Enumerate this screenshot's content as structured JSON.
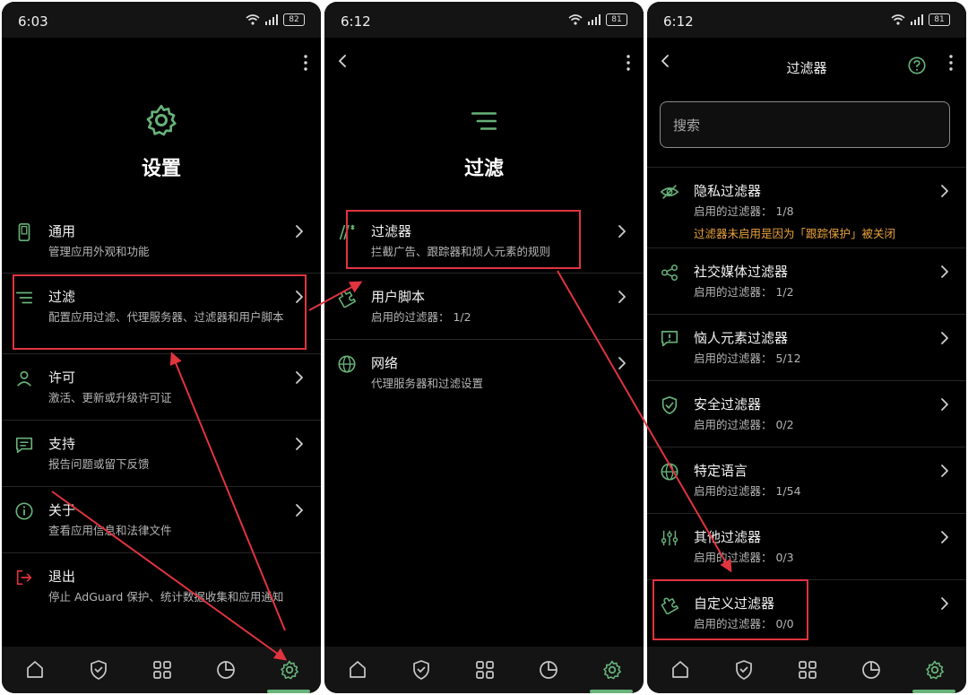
{
  "colors": {
    "accent": "#67b279",
    "highlight": "#e0343f",
    "warning": "#e9a23b"
  },
  "screens": [
    {
      "time": "6:03",
      "battery": "82",
      "title": "设置",
      "items": [
        {
          "icon": "phone-icon",
          "title": "通用",
          "subtitle": "管理应用外观和功能"
        },
        {
          "icon": "filter-lines-icon",
          "title": "过滤",
          "subtitle": "配置应用过滤、代理服务器、过滤器和用户脚本"
        },
        {
          "icon": "person-icon",
          "title": "许可",
          "subtitle": "激活、更新或升级许可证"
        },
        {
          "icon": "chat-icon",
          "title": "支持",
          "subtitle": "报告问题或留下反馈"
        },
        {
          "icon": "info-icon",
          "title": "关于",
          "subtitle": "查看应用信息和法律文件"
        },
        {
          "icon": "exit-icon",
          "title": "退出",
          "subtitle": "停止 AdGuard 保护、统计数据收集和应用通知"
        }
      ]
    },
    {
      "time": "6:12",
      "battery": "81",
      "title": "过滤",
      "items": [
        {
          "icon": "filters-icon",
          "title": "过滤器",
          "subtitle": "拦截广告、跟踪器和烦人元素的规则"
        },
        {
          "icon": "puzzle-icon",
          "title": "用户脚本",
          "subtitle": "启用的过滤器： 1/2"
        },
        {
          "icon": "globe-icon",
          "title": "网络",
          "subtitle": "代理服务器和过滤设置"
        }
      ]
    },
    {
      "time": "6:12",
      "battery": "81",
      "title": "过滤器",
      "search_placeholder": "搜索",
      "items": [
        {
          "icon": "eye-off-icon",
          "title": "隐私过滤器",
          "subtitle": "启用的过滤器： 1/8",
          "warning": "过滤器未启用是因为「跟踪保护」被关闭"
        },
        {
          "icon": "share-icon",
          "title": "社交媒体过滤器",
          "subtitle": "启用的过滤器： 1/2"
        },
        {
          "icon": "alert-message-icon",
          "title": "恼人元素过滤器",
          "subtitle": "启用的过滤器： 5/12"
        },
        {
          "icon": "shield-check-icon",
          "title": "安全过滤器",
          "subtitle": "启用的过滤器： 0/2"
        },
        {
          "icon": "globe-icon",
          "title": "特定语言",
          "subtitle": "启用的过滤器： 1/54"
        },
        {
          "icon": "sliders-icon",
          "title": "其他过滤器",
          "subtitle": "启用的过滤器： 0/3"
        },
        {
          "icon": "puzzle-icon",
          "title": "自定义过滤器",
          "subtitle": "启用的过滤器： 0/0"
        }
      ]
    }
  ]
}
